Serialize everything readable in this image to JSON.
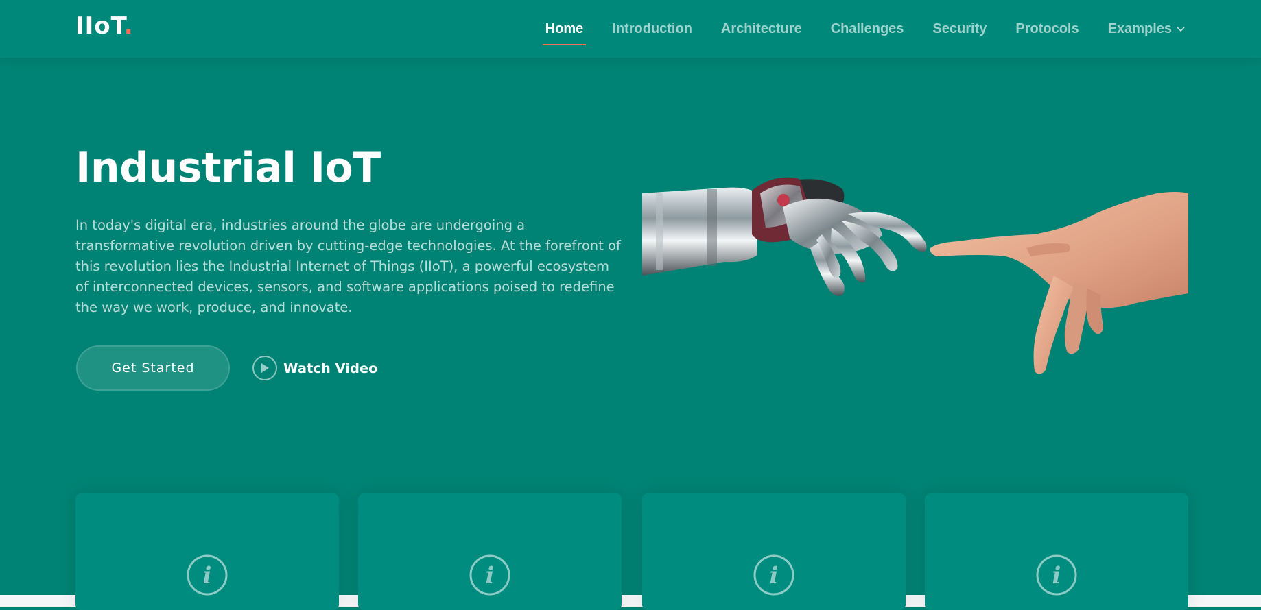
{
  "brand": {
    "name": "IIoT",
    "dot": "."
  },
  "nav": {
    "items": [
      {
        "label": "Home",
        "active": true
      },
      {
        "label": "Introduction"
      },
      {
        "label": "Architecture"
      },
      {
        "label": "Challenges"
      },
      {
        "label": "Security"
      },
      {
        "label": "Protocols"
      },
      {
        "label": "Examples",
        "dropdown": true
      }
    ]
  },
  "hero": {
    "title": "Industrial IoT",
    "description": "In today's digital era, industries around the globe are undergoing a transformative revolution driven by cutting-edge technologies. At the forefront of this revolution lies the Industrial Internet of Things (IIoT), a powerful ecosystem of interconnected devices, sensors, and software applications poised to redefine the way we work, produce, and innovate.",
    "primary_button": "Get Started",
    "secondary_button": "Watch Video",
    "image": "robot-hand-reaching-human-hand"
  },
  "cards": [
    {
      "icon": "info-icon"
    },
    {
      "icon": "info-icon"
    },
    {
      "icon": "info-icon"
    },
    {
      "icon": "info-icon"
    }
  ],
  "colors": {
    "background": "#008374",
    "header": "#00897b",
    "accent": "#f96f59",
    "card": "#008d7f"
  }
}
